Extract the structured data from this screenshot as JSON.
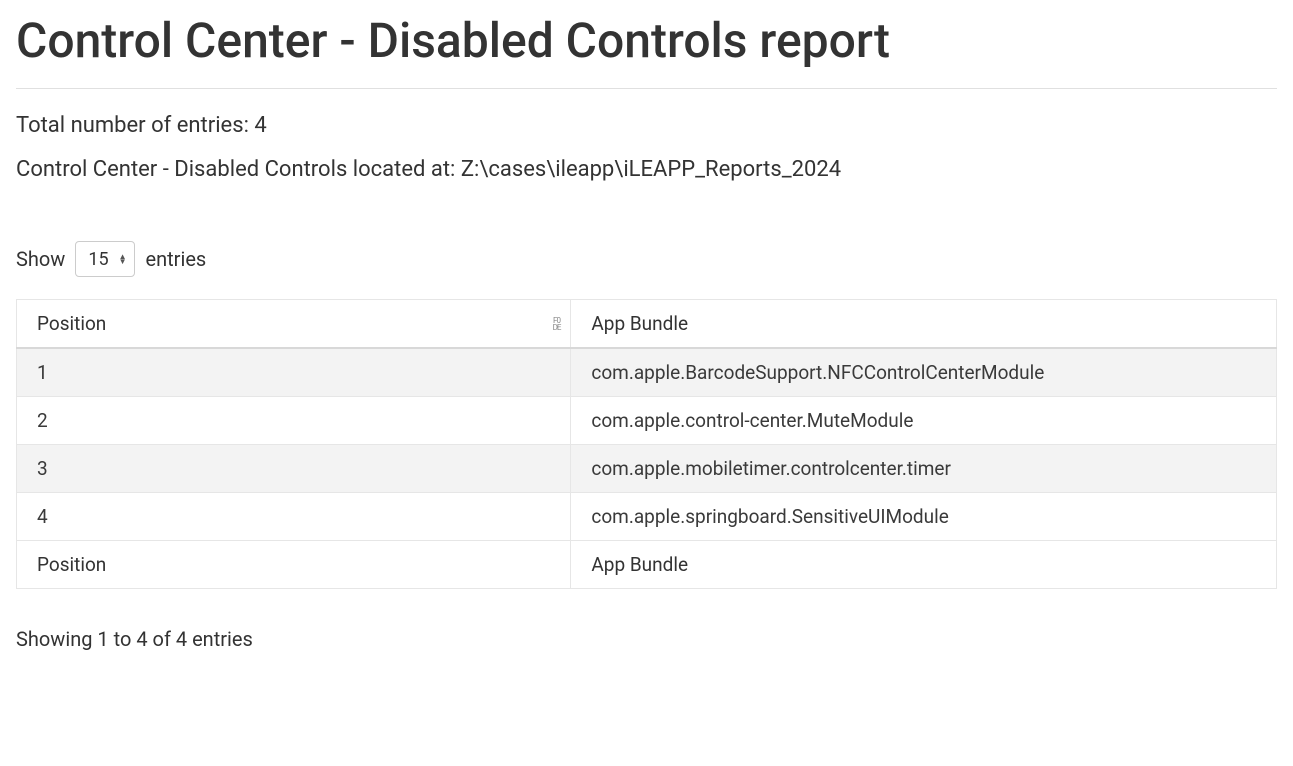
{
  "header": {
    "title": "Control Center - Disabled Controls report"
  },
  "summary": {
    "total_label": "Total number of entries: 4",
    "location_label": "Control Center - Disabled Controls located at: Z:\\cases\\ileapp\\iLEAPP_Reports_2024"
  },
  "length_control": {
    "show_label": "Show",
    "value": "15",
    "entries_label": "entries"
  },
  "table": {
    "columns": {
      "position": "Position",
      "app_bundle": "App Bundle"
    },
    "rows": [
      {
        "position": "1",
        "app_bundle": "com.apple.BarcodeSupport.NFCControlCenterModule"
      },
      {
        "position": "2",
        "app_bundle": "com.apple.control-center.MuteModule"
      },
      {
        "position": "3",
        "app_bundle": "com.apple.mobiletimer.controlcenter.timer"
      },
      {
        "position": "4",
        "app_bundle": "com.apple.springboard.SensitiveUIModule"
      }
    ],
    "footer": {
      "position": "Position",
      "app_bundle": "App Bundle"
    }
  },
  "info": {
    "showing": "Showing 1 to 4 of 4 entries"
  }
}
